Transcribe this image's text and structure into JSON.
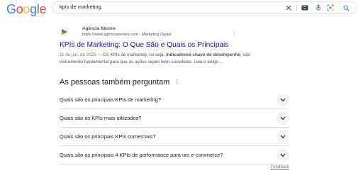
{
  "logo": {
    "letters": [
      "G",
      "o",
      "o",
      "g",
      "l",
      "e"
    ],
    "colors": [
      "#4285f4",
      "#ea4335",
      "#fbbc05",
      "#4285f4",
      "#34a853",
      "#ea4335"
    ]
  },
  "search": {
    "query": "kpis de marketing",
    "icons": [
      "close-icon",
      "keyboard-icon",
      "microphone-icon",
      "lens-icon",
      "search-icon"
    ]
  },
  "result": {
    "site_name": "Agência Mestre",
    "site_url": "https://www.agenciamestre.com › Marketing Digital",
    "more": "⋮",
    "title": "KPIs de Marketing: O Que São e Quais os Principais",
    "date": "11 de jun. de 2025",
    "snippet_pre": " — Os KPIs de marketing, ou seja, ",
    "snippet_bold": "indicadores-chave de desempenho",
    "snippet_post": ", são instrumento fundamental para que as ações sejam bem-sucedidas. Leia o artigo ..."
  },
  "paa": {
    "title": "As pessoas também perguntam",
    "more": "⋮",
    "questions": [
      "Quais são os principais KPIs de marketing?",
      "Quais são os KPIs mais utilizados?",
      "Quais são os principais KPIs comerciais?",
      "Quais são as principais 4 KPIs de performance para um e-commerce?"
    ]
  },
  "feedback": "Feedback"
}
